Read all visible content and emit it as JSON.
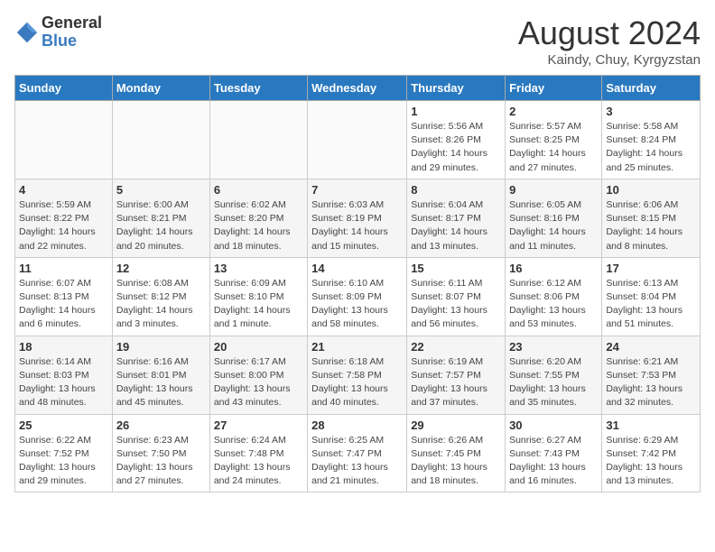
{
  "logo": {
    "general": "General",
    "blue": "Blue"
  },
  "title": {
    "month_year": "August 2024",
    "location": "Kaindy, Chuy, Kyrgyzstan"
  },
  "days_of_week": [
    "Sunday",
    "Monday",
    "Tuesday",
    "Wednesday",
    "Thursday",
    "Friday",
    "Saturday"
  ],
  "weeks": [
    [
      {
        "num": "",
        "info": ""
      },
      {
        "num": "",
        "info": ""
      },
      {
        "num": "",
        "info": ""
      },
      {
        "num": "",
        "info": ""
      },
      {
        "num": "1",
        "info": "Sunrise: 5:56 AM\nSunset: 8:26 PM\nDaylight: 14 hours and 29 minutes."
      },
      {
        "num": "2",
        "info": "Sunrise: 5:57 AM\nSunset: 8:25 PM\nDaylight: 14 hours and 27 minutes."
      },
      {
        "num": "3",
        "info": "Sunrise: 5:58 AM\nSunset: 8:24 PM\nDaylight: 14 hours and 25 minutes."
      }
    ],
    [
      {
        "num": "4",
        "info": "Sunrise: 5:59 AM\nSunset: 8:22 PM\nDaylight: 14 hours and 22 minutes."
      },
      {
        "num": "5",
        "info": "Sunrise: 6:00 AM\nSunset: 8:21 PM\nDaylight: 14 hours and 20 minutes."
      },
      {
        "num": "6",
        "info": "Sunrise: 6:02 AM\nSunset: 8:20 PM\nDaylight: 14 hours and 18 minutes."
      },
      {
        "num": "7",
        "info": "Sunrise: 6:03 AM\nSunset: 8:19 PM\nDaylight: 14 hours and 15 minutes."
      },
      {
        "num": "8",
        "info": "Sunrise: 6:04 AM\nSunset: 8:17 PM\nDaylight: 14 hours and 13 minutes."
      },
      {
        "num": "9",
        "info": "Sunrise: 6:05 AM\nSunset: 8:16 PM\nDaylight: 14 hours and 11 minutes."
      },
      {
        "num": "10",
        "info": "Sunrise: 6:06 AM\nSunset: 8:15 PM\nDaylight: 14 hours and 8 minutes."
      }
    ],
    [
      {
        "num": "11",
        "info": "Sunrise: 6:07 AM\nSunset: 8:13 PM\nDaylight: 14 hours and 6 minutes."
      },
      {
        "num": "12",
        "info": "Sunrise: 6:08 AM\nSunset: 8:12 PM\nDaylight: 14 hours and 3 minutes."
      },
      {
        "num": "13",
        "info": "Sunrise: 6:09 AM\nSunset: 8:10 PM\nDaylight: 14 hours and 1 minute."
      },
      {
        "num": "14",
        "info": "Sunrise: 6:10 AM\nSunset: 8:09 PM\nDaylight: 13 hours and 58 minutes."
      },
      {
        "num": "15",
        "info": "Sunrise: 6:11 AM\nSunset: 8:07 PM\nDaylight: 13 hours and 56 minutes."
      },
      {
        "num": "16",
        "info": "Sunrise: 6:12 AM\nSunset: 8:06 PM\nDaylight: 13 hours and 53 minutes."
      },
      {
        "num": "17",
        "info": "Sunrise: 6:13 AM\nSunset: 8:04 PM\nDaylight: 13 hours and 51 minutes."
      }
    ],
    [
      {
        "num": "18",
        "info": "Sunrise: 6:14 AM\nSunset: 8:03 PM\nDaylight: 13 hours and 48 minutes."
      },
      {
        "num": "19",
        "info": "Sunrise: 6:16 AM\nSunset: 8:01 PM\nDaylight: 13 hours and 45 minutes."
      },
      {
        "num": "20",
        "info": "Sunrise: 6:17 AM\nSunset: 8:00 PM\nDaylight: 13 hours and 43 minutes."
      },
      {
        "num": "21",
        "info": "Sunrise: 6:18 AM\nSunset: 7:58 PM\nDaylight: 13 hours and 40 minutes."
      },
      {
        "num": "22",
        "info": "Sunrise: 6:19 AM\nSunset: 7:57 PM\nDaylight: 13 hours and 37 minutes."
      },
      {
        "num": "23",
        "info": "Sunrise: 6:20 AM\nSunset: 7:55 PM\nDaylight: 13 hours and 35 minutes."
      },
      {
        "num": "24",
        "info": "Sunrise: 6:21 AM\nSunset: 7:53 PM\nDaylight: 13 hours and 32 minutes."
      }
    ],
    [
      {
        "num": "25",
        "info": "Sunrise: 6:22 AM\nSunset: 7:52 PM\nDaylight: 13 hours and 29 minutes."
      },
      {
        "num": "26",
        "info": "Sunrise: 6:23 AM\nSunset: 7:50 PM\nDaylight: 13 hours and 27 minutes."
      },
      {
        "num": "27",
        "info": "Sunrise: 6:24 AM\nSunset: 7:48 PM\nDaylight: 13 hours and 24 minutes."
      },
      {
        "num": "28",
        "info": "Sunrise: 6:25 AM\nSunset: 7:47 PM\nDaylight: 13 hours and 21 minutes."
      },
      {
        "num": "29",
        "info": "Sunrise: 6:26 AM\nSunset: 7:45 PM\nDaylight: 13 hours and 18 minutes."
      },
      {
        "num": "30",
        "info": "Sunrise: 6:27 AM\nSunset: 7:43 PM\nDaylight: 13 hours and 16 minutes."
      },
      {
        "num": "31",
        "info": "Sunrise: 6:29 AM\nSunset: 7:42 PM\nDaylight: 13 hours and 13 minutes."
      }
    ]
  ]
}
